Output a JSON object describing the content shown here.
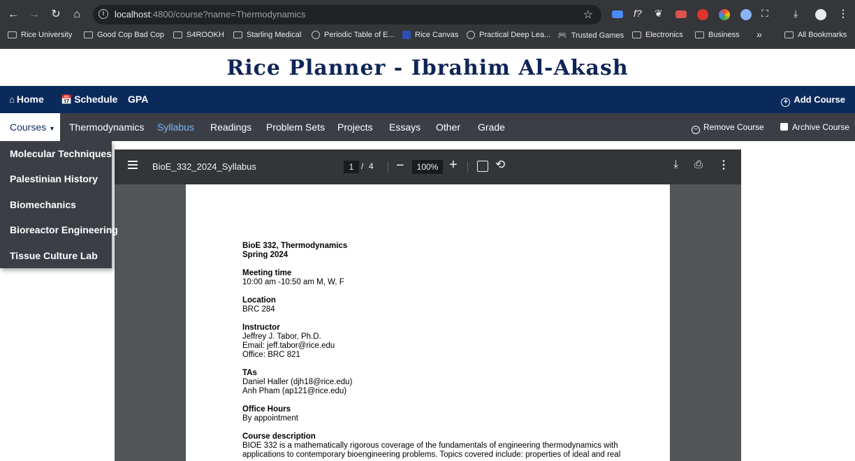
{
  "browser": {
    "url_host": "localhost",
    "url_rest": ":4800/course?name=Thermodynamics",
    "bookmarks": [
      {
        "label": "Rice University",
        "icon": "folder-icon"
      },
      {
        "label": "Good Cop Bad Cop",
        "icon": "folder-icon"
      },
      {
        "label": "S4ROOKH",
        "icon": "folder-icon"
      },
      {
        "label": "Starling Medical",
        "icon": "folder-icon"
      },
      {
        "label": "Periodic Table of E...",
        "icon": "globe-icon"
      },
      {
        "label": "Rice Canvas",
        "icon": "canvas-icon"
      },
      {
        "label": "Practical Deep Lea...",
        "icon": "globe-icon"
      },
      {
        "label": "Trusted Games",
        "icon": "gamepad-icon"
      },
      {
        "label": "Electronics",
        "icon": "folder-icon"
      },
      {
        "label": "Business",
        "icon": "folder-icon"
      }
    ],
    "overflow": "»",
    "all_bookmarks": "All Bookmarks"
  },
  "app": {
    "title": "Rice Planner - Ibrahim Al-Akash",
    "primary_nav": {
      "home": "Home",
      "schedule": "Schedule",
      "gpa": "GPA",
      "add_course": "Add Course"
    },
    "secondary_nav": {
      "courses": "Courses",
      "items": [
        "Thermodynamics",
        "Syllabus",
        "Readings",
        "Problem Sets",
        "Projects",
        "Essays",
        "Other",
        "Grade"
      ],
      "active": "Syllabus",
      "remove_course": "Remove Course",
      "archive_course": "Archive Course"
    },
    "courses_dropdown": [
      "Molecular Techniques",
      "Palestinian History",
      "Biomechanics",
      "Bioreactor Engineering",
      "Tissue Culture Lab"
    ]
  },
  "pdf": {
    "filename": "BioE_332_2024_Syllabus",
    "current_page": "1",
    "separator": "/",
    "total_pages": "4",
    "zoom": "100%",
    "content": {
      "course_line": "BioE 332, Thermodynamics",
      "term": "Spring 2024",
      "meeting_heading": "Meeting time",
      "meeting": "10:00 am -10:50 am M, W, F",
      "location_heading": "Location",
      "location": "BRC 284",
      "instructor_heading": "Instructor",
      "instructor_name": "Jeffrey J. Tabor, Ph.D.",
      "instructor_email": "Email: jeff.tabor@rice.edu",
      "instructor_office": "Office: BRC 821",
      "tas_heading": "TAs",
      "ta1": "Daniel Haller (djh18@rice.edu)",
      "ta2": "Anh Pham (ap121@rice.edu)",
      "office_hours_heading": "Office Hours",
      "office_hours": "By appointment",
      "description_heading": "Course description",
      "description_line1": "BIOE 332 is a mathematically rigorous coverage of the fundamentals of engineering thermodynamics with",
      "description_line2": "applications to contemporary bioengineering problems. Topics covered include: properties of ideal and real"
    }
  }
}
